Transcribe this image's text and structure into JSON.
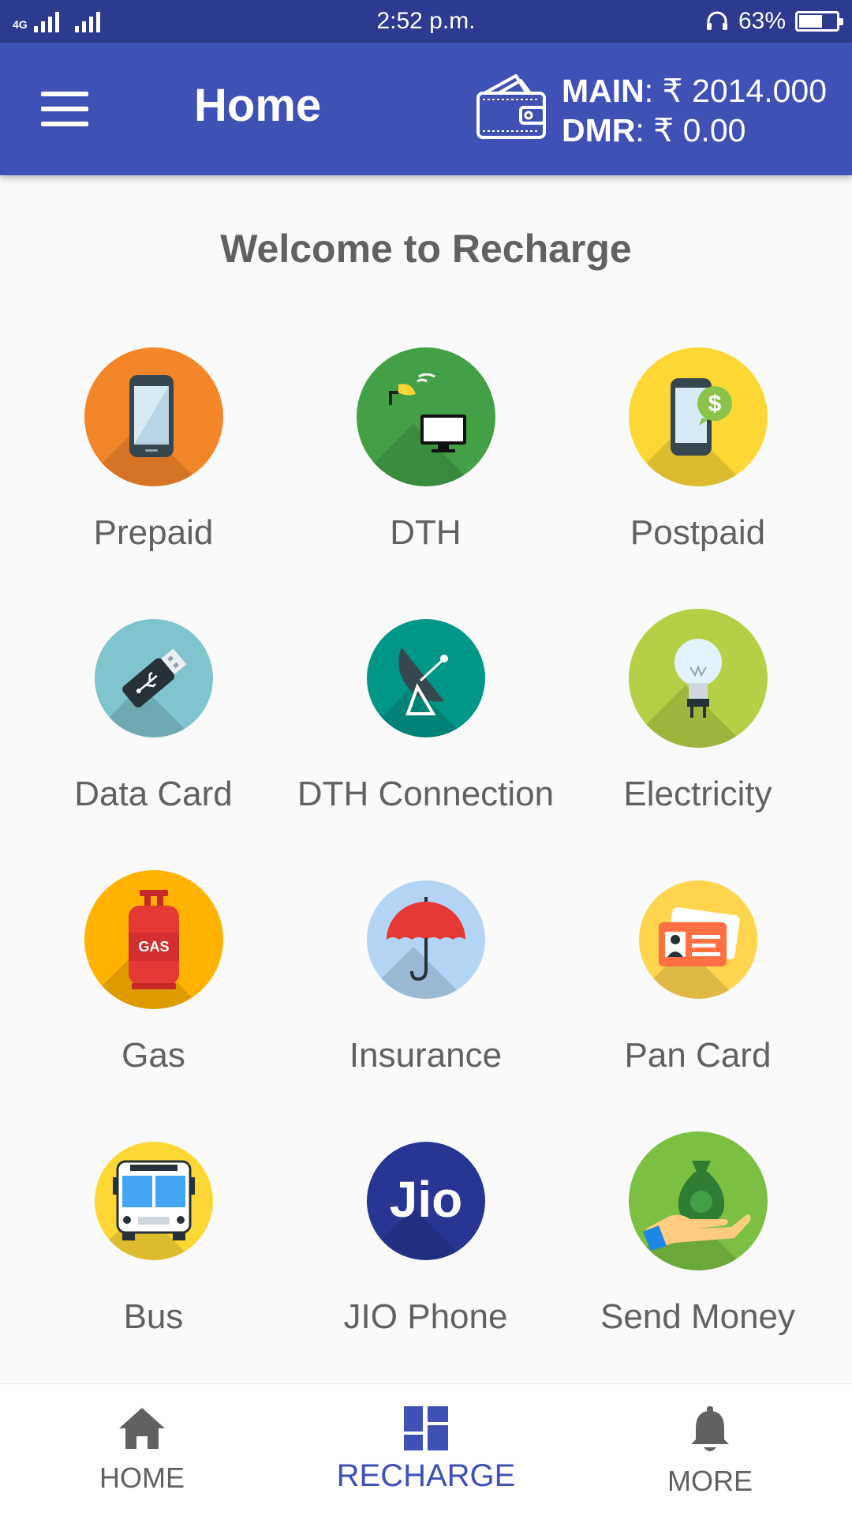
{
  "status_bar": {
    "network": "4G",
    "time": "2:52 p.m.",
    "battery": "63%",
    "battery_level": 0.63
  },
  "header": {
    "title": "Home",
    "main_label": "MAIN",
    "main_value": ": ₹ 2014.000",
    "dmr_label": "DMR",
    "dmr_value": ": ₹ 0.00"
  },
  "welcome": "Welcome to Recharge",
  "services": [
    {
      "label": "Prepaid",
      "icon": "smartphone-icon",
      "color": "#f4862a"
    },
    {
      "label": "DTH",
      "icon": "satellite-tv-icon",
      "color": "#43a047"
    },
    {
      "label": "Postpaid",
      "icon": "phone-dollar-icon",
      "color": "#fdd835"
    },
    {
      "label": "Data Card",
      "icon": "usb-dongle-icon",
      "color": "#80c4cd"
    },
    {
      "label": "DTH Connection",
      "icon": "satellite-dish-icon",
      "color": "#009688"
    },
    {
      "label": "Electricity",
      "icon": "light-bulb-icon",
      "color": "#b5d046"
    },
    {
      "label": "Gas",
      "icon": "gas-cylinder-icon",
      "color": "#ffb300"
    },
    {
      "label": "Insurance",
      "icon": "umbrella-icon",
      "color": "#b3d4f5"
    },
    {
      "label": "Pan Card",
      "icon": "id-card-icon",
      "color": "#ffd54f"
    },
    {
      "label": "Bus",
      "icon": "bus-icon",
      "color": "#fdd835"
    },
    {
      "label": "JIO Phone",
      "icon": "jio-logo-icon",
      "color": "#283593",
      "logo_text": "Jio"
    },
    {
      "label": "Send Money",
      "icon": "money-bag-hand-icon",
      "color": "#7cc043"
    }
  ],
  "bottom_nav": {
    "home": "HOME",
    "recharge": "RECHARGE",
    "more": "MORE"
  },
  "colors": {
    "status_bar": "#2c3a8f",
    "app_bar": "#3f51b5",
    "accent": "#3f51b5",
    "text_gray": "#616161"
  }
}
